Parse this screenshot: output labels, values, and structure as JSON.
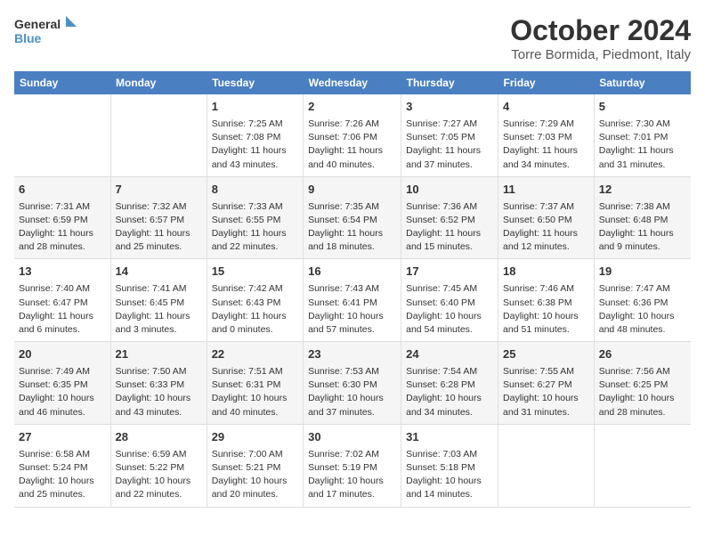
{
  "logo": {
    "line1": "General",
    "line2": "Blue"
  },
  "title": "October 2024",
  "subtitle": "Torre Bormida, Piedmont, Italy",
  "days_of_week": [
    "Sunday",
    "Monday",
    "Tuesday",
    "Wednesday",
    "Thursday",
    "Friday",
    "Saturday"
  ],
  "weeks": [
    [
      {
        "day": "",
        "info": ""
      },
      {
        "day": "",
        "info": ""
      },
      {
        "day": "1",
        "info": "Sunrise: 7:25 AM\nSunset: 7:08 PM\nDaylight: 11 hours and 43 minutes."
      },
      {
        "day": "2",
        "info": "Sunrise: 7:26 AM\nSunset: 7:06 PM\nDaylight: 11 hours and 40 minutes."
      },
      {
        "day": "3",
        "info": "Sunrise: 7:27 AM\nSunset: 7:05 PM\nDaylight: 11 hours and 37 minutes."
      },
      {
        "day": "4",
        "info": "Sunrise: 7:29 AM\nSunset: 7:03 PM\nDaylight: 11 hours and 34 minutes."
      },
      {
        "day": "5",
        "info": "Sunrise: 7:30 AM\nSunset: 7:01 PM\nDaylight: 11 hours and 31 minutes."
      }
    ],
    [
      {
        "day": "6",
        "info": "Sunrise: 7:31 AM\nSunset: 6:59 PM\nDaylight: 11 hours and 28 minutes."
      },
      {
        "day": "7",
        "info": "Sunrise: 7:32 AM\nSunset: 6:57 PM\nDaylight: 11 hours and 25 minutes."
      },
      {
        "day": "8",
        "info": "Sunrise: 7:33 AM\nSunset: 6:55 PM\nDaylight: 11 hours and 22 minutes."
      },
      {
        "day": "9",
        "info": "Sunrise: 7:35 AM\nSunset: 6:54 PM\nDaylight: 11 hours and 18 minutes."
      },
      {
        "day": "10",
        "info": "Sunrise: 7:36 AM\nSunset: 6:52 PM\nDaylight: 11 hours and 15 minutes."
      },
      {
        "day": "11",
        "info": "Sunrise: 7:37 AM\nSunset: 6:50 PM\nDaylight: 11 hours and 12 minutes."
      },
      {
        "day": "12",
        "info": "Sunrise: 7:38 AM\nSunset: 6:48 PM\nDaylight: 11 hours and 9 minutes."
      }
    ],
    [
      {
        "day": "13",
        "info": "Sunrise: 7:40 AM\nSunset: 6:47 PM\nDaylight: 11 hours and 6 minutes."
      },
      {
        "day": "14",
        "info": "Sunrise: 7:41 AM\nSunset: 6:45 PM\nDaylight: 11 hours and 3 minutes."
      },
      {
        "day": "15",
        "info": "Sunrise: 7:42 AM\nSunset: 6:43 PM\nDaylight: 11 hours and 0 minutes."
      },
      {
        "day": "16",
        "info": "Sunrise: 7:43 AM\nSunset: 6:41 PM\nDaylight: 10 hours and 57 minutes."
      },
      {
        "day": "17",
        "info": "Sunrise: 7:45 AM\nSunset: 6:40 PM\nDaylight: 10 hours and 54 minutes."
      },
      {
        "day": "18",
        "info": "Sunrise: 7:46 AM\nSunset: 6:38 PM\nDaylight: 10 hours and 51 minutes."
      },
      {
        "day": "19",
        "info": "Sunrise: 7:47 AM\nSunset: 6:36 PM\nDaylight: 10 hours and 48 minutes."
      }
    ],
    [
      {
        "day": "20",
        "info": "Sunrise: 7:49 AM\nSunset: 6:35 PM\nDaylight: 10 hours and 46 minutes."
      },
      {
        "day": "21",
        "info": "Sunrise: 7:50 AM\nSunset: 6:33 PM\nDaylight: 10 hours and 43 minutes."
      },
      {
        "day": "22",
        "info": "Sunrise: 7:51 AM\nSunset: 6:31 PM\nDaylight: 10 hours and 40 minutes."
      },
      {
        "day": "23",
        "info": "Sunrise: 7:53 AM\nSunset: 6:30 PM\nDaylight: 10 hours and 37 minutes."
      },
      {
        "day": "24",
        "info": "Sunrise: 7:54 AM\nSunset: 6:28 PM\nDaylight: 10 hours and 34 minutes."
      },
      {
        "day": "25",
        "info": "Sunrise: 7:55 AM\nSunset: 6:27 PM\nDaylight: 10 hours and 31 minutes."
      },
      {
        "day": "26",
        "info": "Sunrise: 7:56 AM\nSunset: 6:25 PM\nDaylight: 10 hours and 28 minutes."
      }
    ],
    [
      {
        "day": "27",
        "info": "Sunrise: 6:58 AM\nSunset: 5:24 PM\nDaylight: 10 hours and 25 minutes."
      },
      {
        "day": "28",
        "info": "Sunrise: 6:59 AM\nSunset: 5:22 PM\nDaylight: 10 hours and 22 minutes."
      },
      {
        "day": "29",
        "info": "Sunrise: 7:00 AM\nSunset: 5:21 PM\nDaylight: 10 hours and 20 minutes."
      },
      {
        "day": "30",
        "info": "Sunrise: 7:02 AM\nSunset: 5:19 PM\nDaylight: 10 hours and 17 minutes."
      },
      {
        "day": "31",
        "info": "Sunrise: 7:03 AM\nSunset: 5:18 PM\nDaylight: 10 hours and 14 minutes."
      },
      {
        "day": "",
        "info": ""
      },
      {
        "day": "",
        "info": ""
      }
    ]
  ]
}
